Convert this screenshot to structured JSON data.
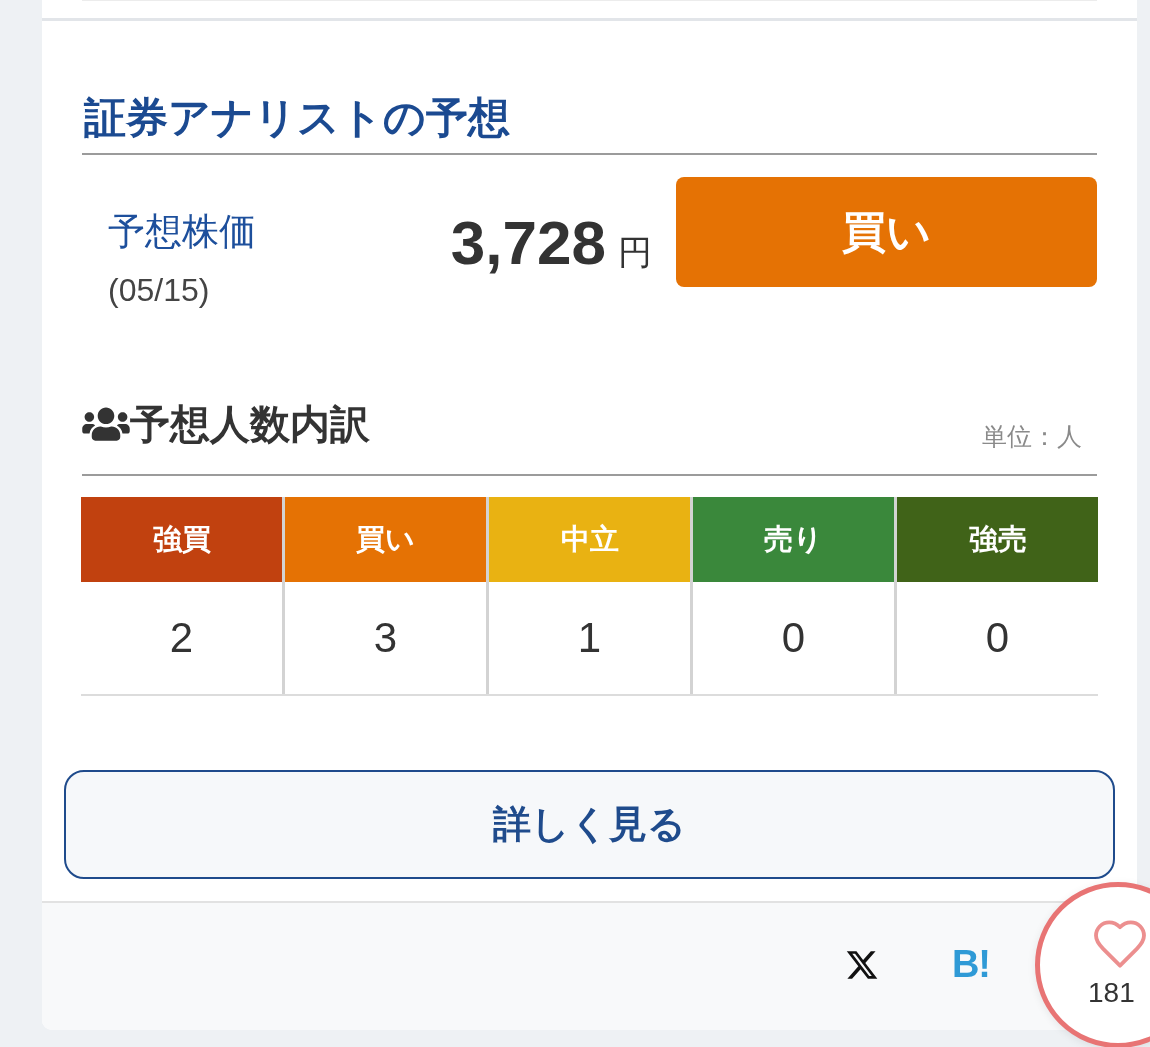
{
  "analyst_section": {
    "title": "証券アナリストの予想"
  },
  "forecast": {
    "label": "予想株価",
    "date": "(05/15)",
    "price": "3,728",
    "unit": "円",
    "rating": {
      "label": "買い",
      "kind": "buy"
    }
  },
  "breakdown": {
    "title": "予想人数内訳",
    "unit_note": "単位：人",
    "columns": [
      {
        "label": "強買",
        "color": "#c1410f",
        "count": "2"
      },
      {
        "label": "買い",
        "color": "#e57204",
        "count": "3"
      },
      {
        "label": "中立",
        "color": "#e9b212",
        "count": "1"
      },
      {
        "label": "売り",
        "color": "#3a883b",
        "count": "0"
      },
      {
        "label": "強売",
        "color": "#406318",
        "count": "0"
      }
    ]
  },
  "more_button": {
    "label": "詳しく見る"
  },
  "share_bar": {
    "bookmark_label": "B!",
    "like_count": "181"
  }
}
